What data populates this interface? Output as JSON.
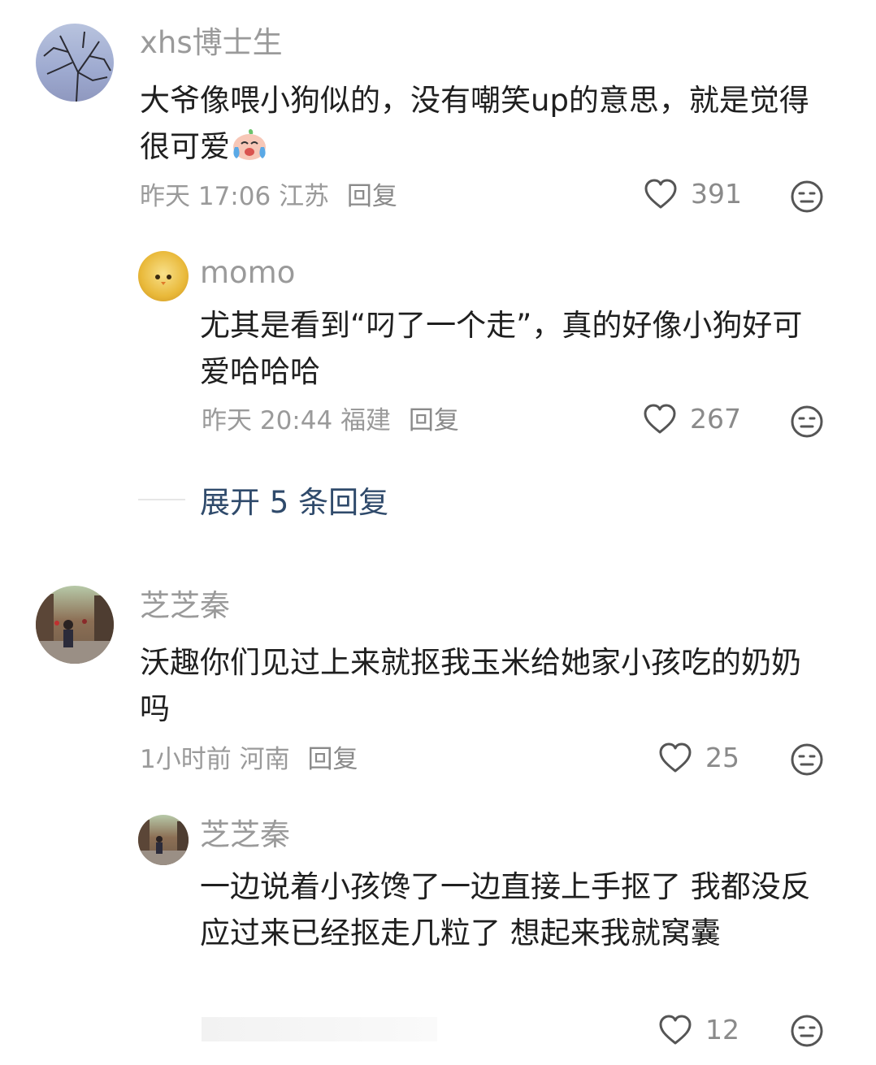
{
  "comments": [
    {
      "username": "xhs博士生",
      "text": "大爷像喂小狗似的，没有嘲笑up的意思，就是觉得很可爱",
      "time": "昨天 17:06",
      "location": "江苏",
      "reply_label": "回复",
      "likes": "391",
      "emoji": "crying-laughing-emoji"
    },
    {
      "username": "momo",
      "text": "尤其是看到“叼了一个走”，真的好像小狗好可爱哈哈哈",
      "time": "昨天 20:44",
      "location": "福建",
      "reply_label": "回复",
      "likes": "267"
    },
    {
      "username": "芝芝秦",
      "text": "沃趣你们见过上来就抠我玉米给她家小孩吃的奶奶吗",
      "time": "1小时前",
      "location": "河南",
      "reply_label": "回复",
      "likes": "25"
    },
    {
      "username": "芝芝秦",
      "text": "一边说着小孩馋了一边直接上手抠了 我都没反应过来已经抠走几粒了 想起来我就窝囊",
      "likes": "12"
    }
  ],
  "expand_replies": {
    "label": "展开 5 条回复"
  },
  "colors": {
    "username": "#9a9a9a",
    "body_text": "#1f1f1f",
    "expand_link": "#2f4a6b"
  },
  "icons": [
    "heart-outline-icon",
    "neutral-face-icon"
  ]
}
